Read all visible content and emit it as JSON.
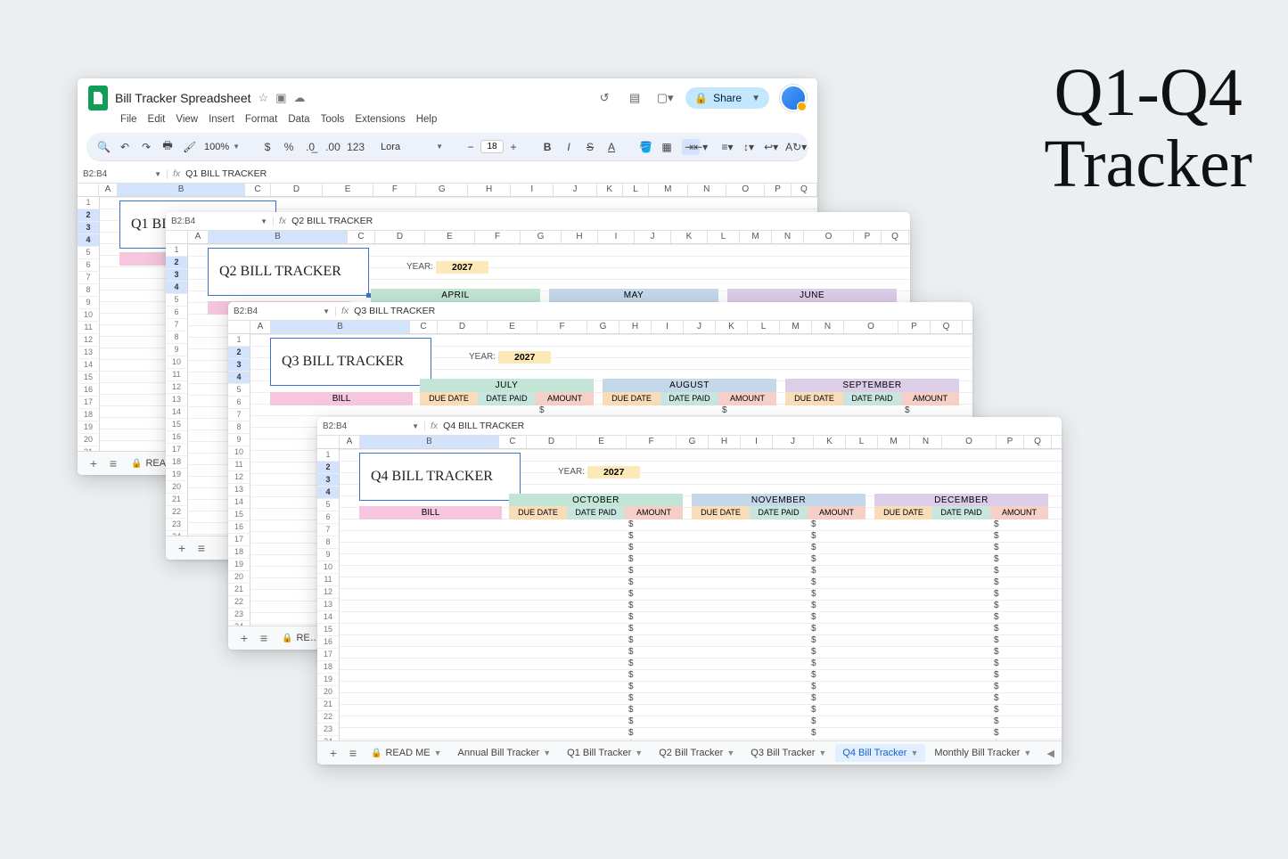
{
  "promo_title_line1": "Q1-Q4",
  "promo_title_line2": "Tracker",
  "doc": {
    "name": "Bill Tracker Spreadsheet"
  },
  "menubar": [
    "File",
    "Edit",
    "View",
    "Insert",
    "Format",
    "Data",
    "Tools",
    "Extensions",
    "Help"
  ],
  "share_label": "Share",
  "toolbar": {
    "zoom": "100%",
    "font": "Lora",
    "font_size": "18"
  },
  "columns": [
    "A",
    "B",
    "C",
    "D",
    "E",
    "F",
    "G",
    "H",
    "I",
    "J",
    "K",
    "L",
    "M",
    "N",
    "O",
    "P",
    "Q"
  ],
  "year_label": "YEAR:",
  "sub_headers": [
    "DUE DATE",
    "DATE PAID",
    "AMOUNT"
  ],
  "bill_label": "BILL",
  "amount_placeholder": "$",
  "sheets": {
    "q1": {
      "ref": "B2:B4",
      "fx": "Q1 BILL TRACKER",
      "title": "Q1 BILL TRACKER",
      "year": "2027"
    },
    "q2": {
      "ref": "B2:B4",
      "fx": "Q2 BILL TRACKER",
      "title": "Q2 BILL TRACKER",
      "year": "2027",
      "months": [
        "APRIL",
        "MAY",
        "JUNE"
      ]
    },
    "q3": {
      "ref": "B2:B4",
      "fx": "Q3 BILL TRACKER",
      "title": "Q3 BILL TRACKER",
      "year": "2027",
      "months": [
        "JULY",
        "AUGUST",
        "SEPTEMBER"
      ]
    },
    "q4": {
      "ref": "B2:B4",
      "fx": "Q4 BILL TRACKER",
      "title": "Q4 BILL TRACKER",
      "year": "2027",
      "months": [
        "OCTOBER",
        "NOVEMBER",
        "DECEMBER"
      ]
    }
  },
  "tabs": [
    {
      "label": "READ ME",
      "locked": true
    },
    {
      "label": "Annual Bill Tracker"
    },
    {
      "label": "Q1 Bill Tracker"
    },
    {
      "label": "Q2 Bill Tracker"
    },
    {
      "label": "Q3 Bill Tracker"
    },
    {
      "label": "Q4 Bill Tracker",
      "active": true
    },
    {
      "label": "Monthly Bill Tracker"
    }
  ]
}
